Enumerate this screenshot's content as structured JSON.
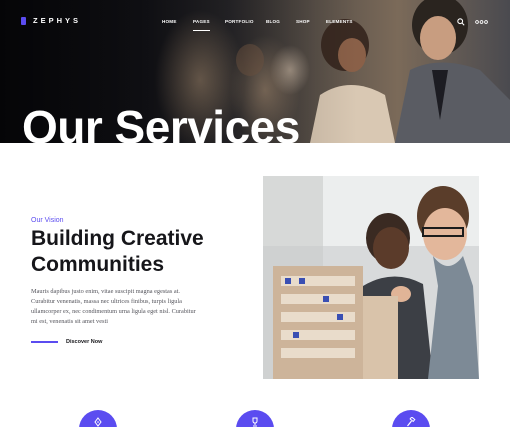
{
  "brand": {
    "name": "ZEPHYS",
    "accent": "#5b4cf0"
  },
  "nav": {
    "items": [
      {
        "label": "HOME"
      },
      {
        "label": "PAGES",
        "active": true
      },
      {
        "label": "PORTFOLIO"
      },
      {
        "label": "BLOG"
      },
      {
        "label": "SHOP"
      },
      {
        "label": "ELEMENTS"
      }
    ],
    "icons": [
      "search-icon",
      "more-dots-icon"
    ]
  },
  "hero": {
    "title": "Our Services"
  },
  "section": {
    "eyebrow": "Our Vision",
    "heading_line1": "Building Creative",
    "heading_line2": "Communities",
    "body_line1": "Mauris dapibus justo enim, vitae suscipit magna egestas at.",
    "body_line2": "Curabitur venenatis, massa nec ultrices finibus, turpis ligula",
    "body_line3": "ullamcorper ex, nec condimentum urna ligula eget nisl. Curabitur",
    "body_line4": "mi est, venenatis sit amet vesti",
    "cta_label": "Discover Now"
  },
  "features": {
    "icons": [
      "pen-nib-icon",
      "trophy-icon",
      "hammer-icon"
    ]
  }
}
